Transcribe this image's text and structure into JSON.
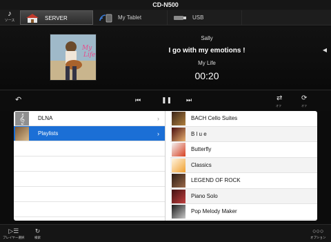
{
  "titlebar": {
    "title": "CD-N500"
  },
  "source_button": {
    "icon": "music-note-icon",
    "label": "ソース"
  },
  "tabs": [
    {
      "label": "SERVER",
      "icon": "house-icon",
      "active": true
    },
    {
      "label": "My Tablet",
      "icon": "wifi-tablet-icon",
      "active": false
    },
    {
      "label": "USB",
      "icon": "usb-drive-icon",
      "active": false
    }
  ],
  "now_playing": {
    "artist": "Sally",
    "title": "I go with my emotions !",
    "album": "My Life",
    "time": "00:20"
  },
  "controls": {
    "back_label": "↶",
    "prev_label": "⏮",
    "play_pause_label": "❚❚",
    "next_label": "⏭",
    "shuffle_icon": "shuffle-icon",
    "shuffle_state": "オフ",
    "repeat_icon": "repeat-icon",
    "repeat_state": "オフ"
  },
  "browser": {
    "left_items": [
      {
        "label": "DLNA",
        "icon": "treble-clef-icon",
        "selected": false
      },
      {
        "label": "Playlists",
        "icon": "playlist-photo-icon",
        "selected": true
      }
    ],
    "right_items": [
      {
        "label": "BACH Cello Suites"
      },
      {
        "label": "B l u e"
      },
      {
        "label": "Butterfly"
      },
      {
        "label": "Classics"
      },
      {
        "label": "LEGEND OF ROCK"
      },
      {
        "label": "Piano Solo"
      },
      {
        "label": "Pop Melody Maker"
      }
    ]
  },
  "bottom_bar": {
    "player_select": "プレイヤー選択",
    "refresh": "検索",
    "options": "オプション"
  }
}
